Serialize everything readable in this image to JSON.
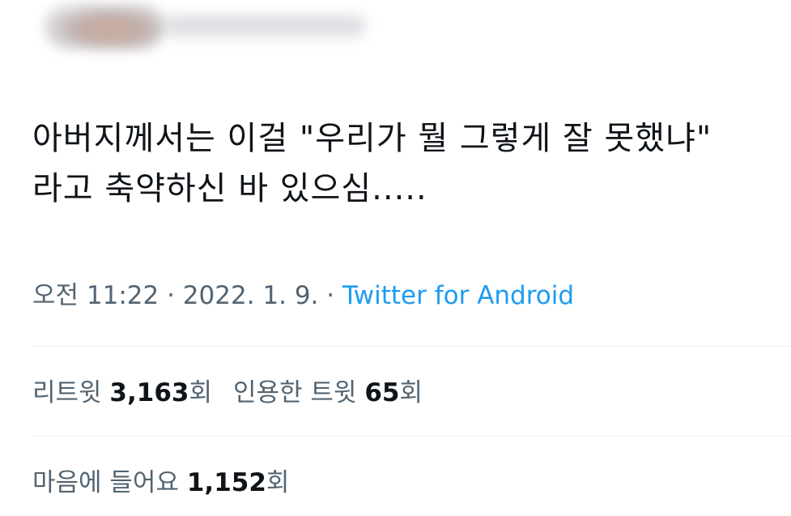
{
  "tweet": {
    "text": "아버지께서는 이걸 \"우리가 뭘 그렇게 잘 못했냐\" 라고 축약하신 바 있으심....."
  },
  "meta": {
    "time": "오전 11:22",
    "separator1": " · ",
    "date": "2022. 1. 9.",
    "separator2": " · ",
    "source": "Twitter for Android"
  },
  "stats": {
    "retweets_label": "리트윗",
    "retweets_count": "3,163",
    "retweets_unit": "회",
    "quotes_label": "인용한 트윗",
    "quotes_count": "65",
    "quotes_unit": "회",
    "likes_label": "마음에 들어요",
    "likes_count": "1,152",
    "likes_unit": "회"
  },
  "colors": {
    "text": "#0f1419",
    "secondary": "#536471",
    "link": "#1d9bf0",
    "divider": "#eff3f4"
  }
}
